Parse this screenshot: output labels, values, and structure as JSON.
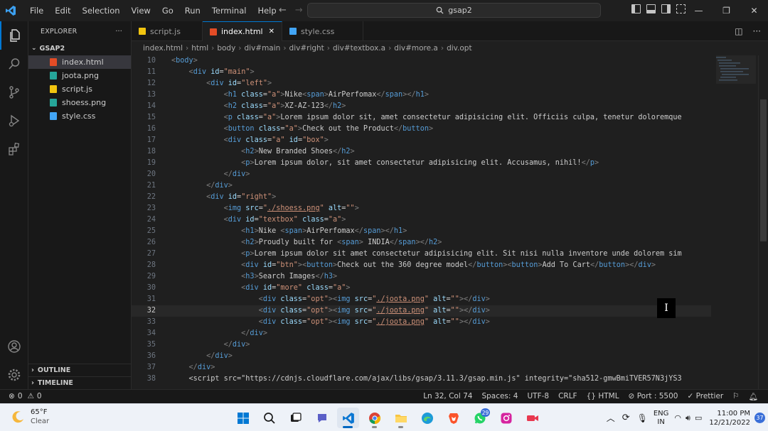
{
  "titlebar": {
    "menu": [
      "File",
      "Edit",
      "Selection",
      "View",
      "Go",
      "Run",
      "Terminal",
      "Help"
    ],
    "search": "gsap2"
  },
  "sidebar": {
    "title": "EXPLORER",
    "folder": "GSAP2",
    "files": [
      {
        "name": "index.html",
        "icon_color": "#e34c26"
      },
      {
        "name": "joota.png",
        "icon_color": "#26a69a"
      },
      {
        "name": "script.js",
        "icon_color": "#f1c40f"
      },
      {
        "name": "shoess.png",
        "icon_color": "#26a69a"
      },
      {
        "name": "style.css",
        "icon_color": "#42a5f5"
      }
    ],
    "outline": "OUTLINE",
    "timeline": "TIMELINE"
  },
  "tabs": [
    {
      "label": "script.js",
      "icon_color": "#f1c40f"
    },
    {
      "label": "index.html",
      "icon_color": "#e34c26"
    },
    {
      "label": "style.css",
      "icon_color": "#42a5f5"
    }
  ],
  "breadcrumb": [
    "index.html",
    "html",
    "body",
    "div#main",
    "div#right",
    "div#textbox.a",
    "div#more.a",
    "div.opt"
  ],
  "editor": {
    "line_numbers": [
      "10",
      "11",
      "12",
      "13",
      "14",
      "15",
      "16",
      "17",
      "18",
      "19",
      "20",
      "21",
      "22",
      "23",
      "24",
      "25",
      "26",
      "27",
      "28",
      "29",
      "30",
      "31",
      "32",
      "33",
      "34",
      "35",
      "36",
      "37",
      "38"
    ],
    "lines": [
      "<body>",
      "    <div id=\"main\">",
      "        <div id=\"left\">",
      "            <h1 class=\"a\">Nike<span>AirPerfomax</span></h1>",
      "            <h2 class=\"a\">XZ-AZ-123</h2>",
      "            <p class=\"a\">Lorem ipsum dolor sit, amet consectetur adipisicing elit. Officiis culpa, tenetur doloremque",
      "            <button class=\"a\">Check out the Product</button>",
      "            <div class=\"a\" id=\"box\">",
      "                <h2>New Branded Shoes</h2>",
      "                <p>Lorem ipsum dolor, sit amet consectetur adipisicing elit. Accusamus, nihil!</p>",
      "            </div>",
      "        </div>",
      "        <div id=\"right\">",
      "            <img src=\"./shoess.png\" alt=\"\">",
      "            <div id=\"textbox\" class=\"a\">",
      "                <h1>Nike <span>AirPerfomax</span></h1>",
      "                <h2>Proudly built for <span> INDIA</span></h2>",
      "                <p>Lorem ipsum dolor sit amet consectetur adipisicing elit. Sit nisi nulla inventore unde dolorem sim",
      "                <div id=\"btn\"><button>Check out the 360 degree model</button><button>Add To Cart</button></div>",
      "                <h3>Search Images</h3>",
      "                <div id=\"more\" class=\"a\">",
      "                    <div class=\"opt\"><img src=\"./joota.png\" alt=\"\"></div>",
      "                    <div class=\"opt\"><img src=\"./joota.png\" alt=\"\"></div>",
      "                    <div class=\"opt\"><img src=\"./joota.png\" alt=\"\"></div>",
      "                </div>",
      "            </div>",
      "        </div>",
      "    </div>",
      "    <script src=\"https://cdnjs.cloudflare.com/ajax/libs/gsap/3.11.3/gsap.min.js\" integrity=\"sha512-gmwBmiTVER57N3jYS3"
    ],
    "current_line": "32"
  },
  "statusbar": {
    "errors": "0",
    "warnings": "0",
    "position": "Ln 32, Col 74",
    "spaces": "Spaces: 4",
    "encoding": "UTF-8",
    "eol": "CRLF",
    "language": "HTML",
    "port": "Port : 5500",
    "formatter": "Prettier"
  },
  "taskbar": {
    "temp": "65°F",
    "condition": "Clear",
    "whatsapp_badge": "29",
    "lang1": "ENG",
    "lang2": "IN",
    "time": "11:00 PM",
    "date": "12/21/2022",
    "notifications": "37"
  }
}
